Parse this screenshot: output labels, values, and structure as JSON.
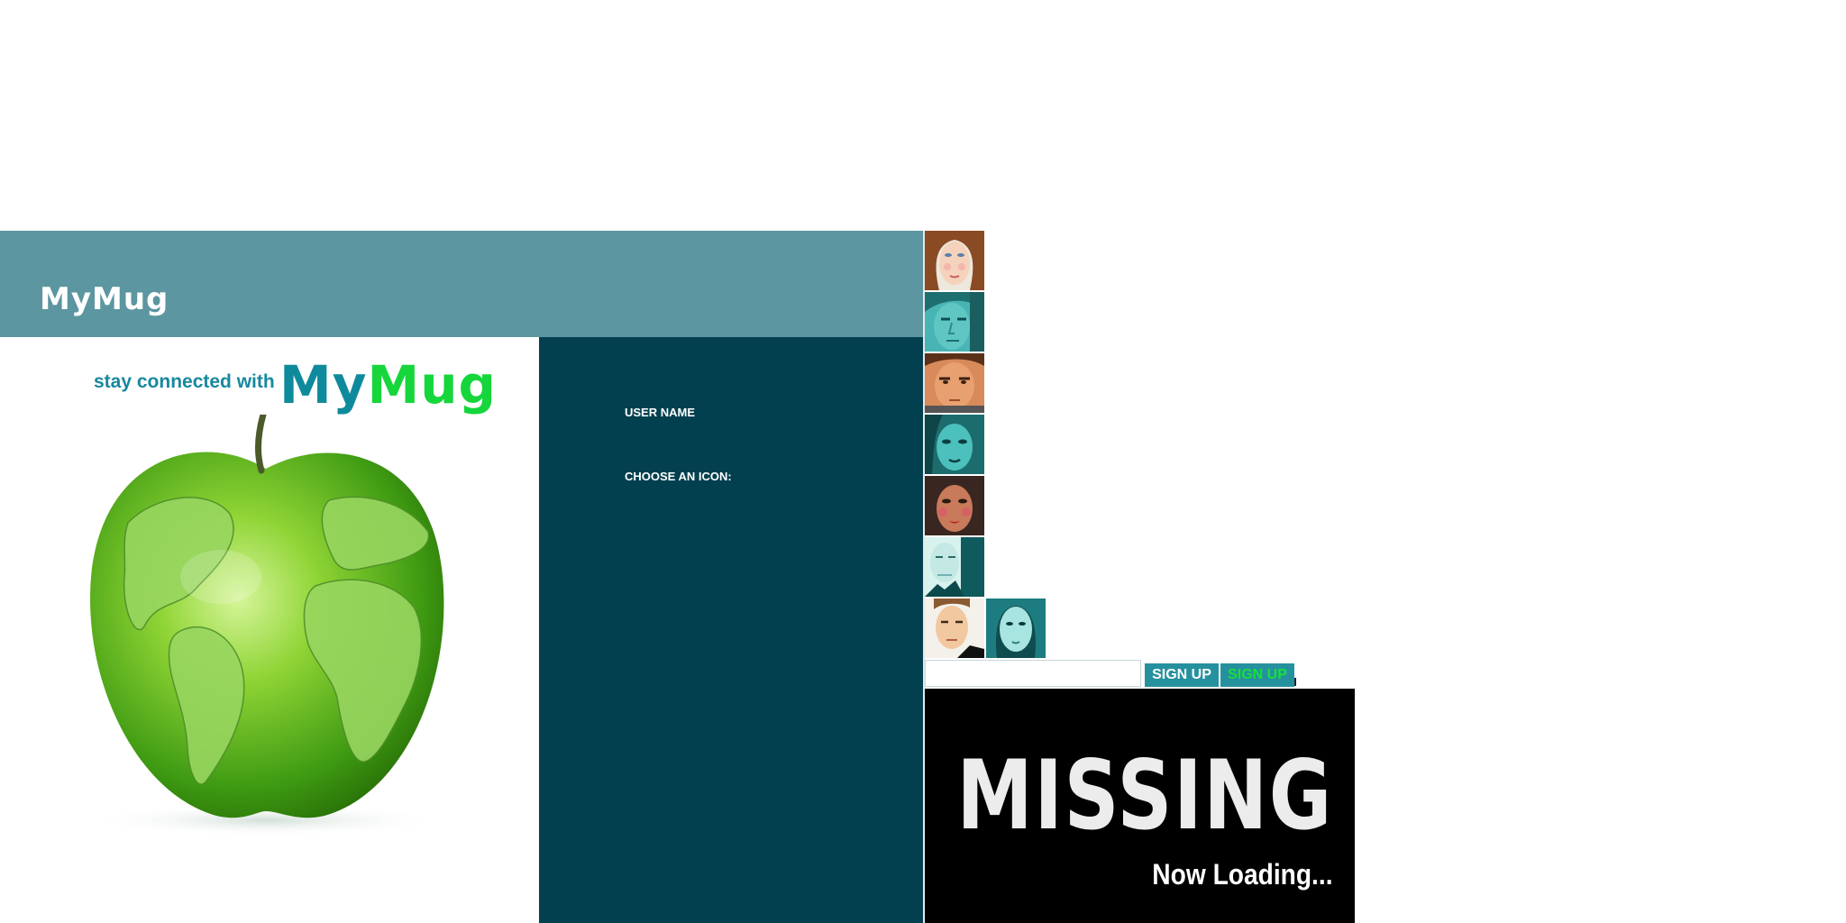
{
  "header": {
    "logo": "MyMug"
  },
  "promo": {
    "tagline": "stay connected with",
    "brand_part1": "My",
    "brand_part2": "Mug"
  },
  "form": {
    "username_label": "USER NAME",
    "icon_label": "CHOOSE AN ICON:"
  },
  "avatars": [
    {
      "name": "avatar-woman-redhair"
    },
    {
      "name": "avatar-man-teal"
    },
    {
      "name": "avatar-man-tan"
    },
    {
      "name": "avatar-woman-teal"
    },
    {
      "name": "avatar-woman-darkhair"
    },
    {
      "name": "avatar-man-teal-suit"
    },
    {
      "name": "avatar-man-light"
    },
    {
      "name": "avatar-woman-teal-2"
    }
  ],
  "signup": {
    "input_value": "",
    "button_label": "SIGN UP",
    "button_hover_label": "SIGN UP"
  },
  "loading": {
    "title": "MISSING",
    "subtitle": "Now Loading..."
  },
  "colors": {
    "header": "#5c96a0",
    "form_panel": "#03404f",
    "brand_teal": "#0f8a9c",
    "brand_green": "#16d63c",
    "button": "#26919e"
  }
}
